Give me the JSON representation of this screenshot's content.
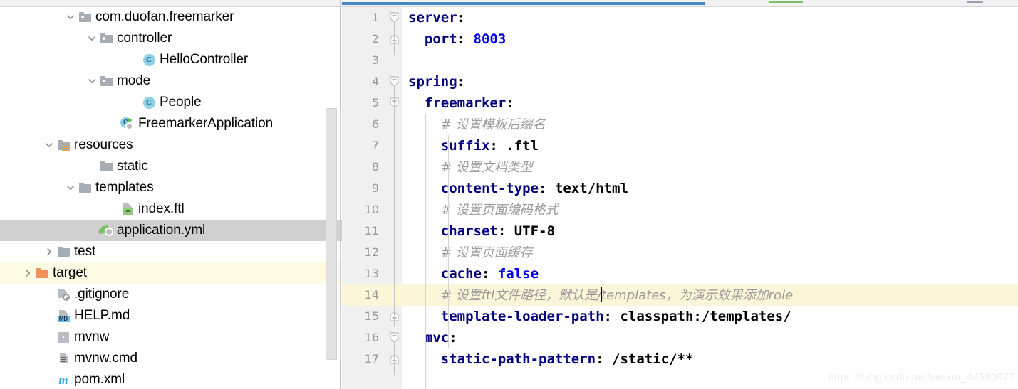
{
  "project_tree": {
    "panel_name": "project-tool-window",
    "rows": [
      {
        "label": "com.duofan.freemarker",
        "indent": 3,
        "twisty": "down",
        "icon": "package-folder-icon",
        "state": "normal"
      },
      {
        "label": "controller",
        "indent": 4,
        "twisty": "down",
        "icon": "package-folder-icon",
        "state": "normal"
      },
      {
        "label": "HelloController",
        "indent": 6,
        "twisty": "none",
        "icon": "java-class-icon",
        "state": "normal"
      },
      {
        "label": "mode",
        "indent": 4,
        "twisty": "down",
        "icon": "package-folder-icon",
        "state": "normal"
      },
      {
        "label": "People",
        "indent": 6,
        "twisty": "none",
        "icon": "java-class-icon",
        "state": "normal"
      },
      {
        "label": "FreemarkerApplication",
        "indent": 5,
        "twisty": "none",
        "icon": "spring-boot-run-class-icon",
        "state": "normal"
      },
      {
        "label": "resources",
        "indent": 2,
        "twisty": "down",
        "icon": "resources-folder-icon",
        "state": "normal"
      },
      {
        "label": "static",
        "indent": 4,
        "twisty": "none",
        "icon": "folder-icon",
        "state": "normal"
      },
      {
        "label": "templates",
        "indent": 3,
        "twisty": "down",
        "icon": "folder-icon",
        "state": "normal"
      },
      {
        "label": "index.ftl",
        "indent": 5,
        "twisty": "none",
        "icon": "ftl-file-icon",
        "state": "normal"
      },
      {
        "label": "application.yml",
        "indent": 4,
        "twisty": "none",
        "icon": "yaml-spring-file-icon",
        "state": "selected"
      },
      {
        "label": "test",
        "indent": 2,
        "twisty": "right",
        "icon": "folder-icon",
        "state": "normal"
      },
      {
        "label": "target",
        "indent": 1,
        "twisty": "right",
        "icon": "target-folder-icon",
        "state": "highlighted"
      },
      {
        "label": ".gitignore",
        "indent": 2,
        "twisty": "none",
        "icon": "gitignore-file-icon",
        "state": "normal"
      },
      {
        "label": "HELP.md",
        "indent": 2,
        "twisty": "none",
        "icon": "markdown-file-icon",
        "state": "normal"
      },
      {
        "label": "mvnw",
        "indent": 2,
        "twisty": "none",
        "icon": "shell-script-icon",
        "state": "normal"
      },
      {
        "label": "mvnw.cmd",
        "indent": 2,
        "twisty": "none",
        "icon": "cmd-script-icon",
        "state": "normal"
      },
      {
        "label": "pom.xml",
        "indent": 2,
        "twisty": "none",
        "icon": "maven-pom-icon",
        "state": "normal"
      }
    ]
  },
  "editor": {
    "name": "application-yml-editor",
    "current_line": 14,
    "lines": [
      {
        "n": "1",
        "fold": "expanded-start",
        "segments": [
          {
            "t": "server",
            "c": "k"
          },
          {
            "t": ":",
            "c": "punc"
          }
        ]
      },
      {
        "n": "2",
        "fold": "end",
        "segments": [
          {
            "t": "  ",
            "c": "punc"
          },
          {
            "t": "port",
            "c": "k"
          },
          {
            "t": ": ",
            "c": "punc"
          },
          {
            "t": "8003",
            "c": "num"
          }
        ]
      },
      {
        "n": "3",
        "fold": "none",
        "segments": []
      },
      {
        "n": "4",
        "fold": "expanded-start",
        "segments": [
          {
            "t": "spring",
            "c": "k"
          },
          {
            "t": ":",
            "c": "punc"
          }
        ]
      },
      {
        "n": "5",
        "fold": "expanded-start",
        "segments": [
          {
            "t": "  ",
            "c": "punc"
          },
          {
            "t": "freemarker",
            "c": "k"
          },
          {
            "t": ":",
            "c": "punc"
          }
        ]
      },
      {
        "n": "6",
        "fold": "none",
        "segments": [
          {
            "t": "    ",
            "c": "punc"
          },
          {
            "t": "# 设置模板后缀名",
            "c": "cmt"
          }
        ]
      },
      {
        "n": "7",
        "fold": "none",
        "segments": [
          {
            "t": "    ",
            "c": "punc"
          },
          {
            "t": "suffix",
            "c": "k"
          },
          {
            "t": ": ",
            "c": "punc"
          },
          {
            "t": ".ftl",
            "c": "str"
          }
        ]
      },
      {
        "n": "8",
        "fold": "none",
        "segments": [
          {
            "t": "    ",
            "c": "punc"
          },
          {
            "t": "# 设置文档类型",
            "c": "cmt"
          }
        ]
      },
      {
        "n": "9",
        "fold": "none",
        "segments": [
          {
            "t": "    ",
            "c": "punc"
          },
          {
            "t": "content-type",
            "c": "k"
          },
          {
            "t": ": ",
            "c": "punc"
          },
          {
            "t": "text/html",
            "c": "str"
          }
        ]
      },
      {
        "n": "10",
        "fold": "none",
        "segments": [
          {
            "t": "    ",
            "c": "punc"
          },
          {
            "t": "# 设置页面编码格式",
            "c": "cmt"
          }
        ]
      },
      {
        "n": "11",
        "fold": "none",
        "segments": [
          {
            "t": "    ",
            "c": "punc"
          },
          {
            "t": "charset",
            "c": "k"
          },
          {
            "t": ": ",
            "c": "punc"
          },
          {
            "t": "UTF-8",
            "c": "str"
          }
        ]
      },
      {
        "n": "12",
        "fold": "none",
        "segments": [
          {
            "t": "    ",
            "c": "punc"
          },
          {
            "t": "# 设置页面缓存",
            "c": "cmt"
          }
        ]
      },
      {
        "n": "13",
        "fold": "none",
        "segments": [
          {
            "t": "    ",
            "c": "punc"
          },
          {
            "t": "cache",
            "c": "k"
          },
          {
            "t": ": ",
            "c": "punc"
          },
          {
            "t": "false",
            "c": "bool"
          }
        ]
      },
      {
        "n": "14",
        "fold": "none",
        "current": true,
        "segments": [
          {
            "t": "    ",
            "c": "punc"
          },
          {
            "t": "# 设置ftl文件路径，默认是/",
            "c": "cmt"
          },
          {
            "t": "CARET",
            "c": "caret"
          },
          {
            "t": "templates，为演示效果添加role",
            "c": "cmt"
          }
        ]
      },
      {
        "n": "15",
        "fold": "end",
        "segments": [
          {
            "t": "    ",
            "c": "punc"
          },
          {
            "t": "template-loader-path",
            "c": "k"
          },
          {
            "t": ": ",
            "c": "punc"
          },
          {
            "t": "classpath:/templates/",
            "c": "str"
          }
        ]
      },
      {
        "n": "16",
        "fold": "expanded-start",
        "segments": [
          {
            "t": "  ",
            "c": "punc"
          },
          {
            "t": "mvc",
            "c": "k"
          },
          {
            "t": ":",
            "c": "punc"
          }
        ]
      },
      {
        "n": "17",
        "fold": "end",
        "segments": [
          {
            "t": "    ",
            "c": "punc"
          },
          {
            "t": "static-path-pattern",
            "c": "k"
          },
          {
            "t": ": ",
            "c": "punc"
          },
          {
            "t": "/static/**",
            "c": "str"
          }
        ]
      }
    ]
  },
  "watermark": {
    "text": "https://blog.csdn.net/weixin_44580977"
  },
  "colors": {
    "tab_underline": "#4387c7",
    "selected_row": "#d0d0d0",
    "highlight_row": "#fdfbe3",
    "current_line": "#fcf6d9",
    "key": "#000080",
    "number": "#0000ee",
    "comment": "#9a9a9a",
    "gutter_bg": "#f0f0f0",
    "marker_green": "#7cc267",
    "marker_gray": "#9aa1b0"
  }
}
